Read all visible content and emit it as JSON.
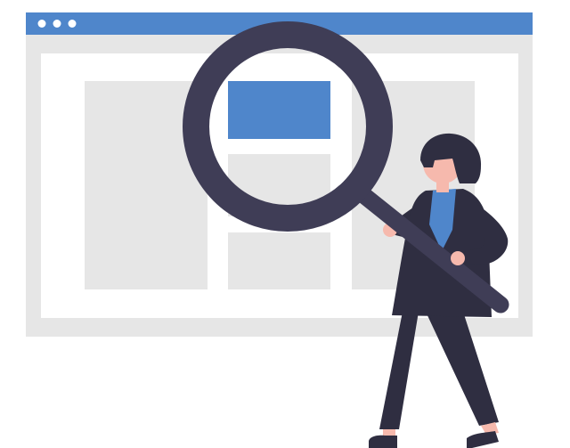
{
  "colors": {
    "background": "#ffffff",
    "titlebar": "#4f86cb",
    "window_frame": "#e6e6e6",
    "content_bg": "#ffffff",
    "panel": "#e6e6e6",
    "highlight_panel": "#4f86cb",
    "lens_ring": "#3f3d56",
    "lens_shadow": "#2f2e41",
    "clothing_dark": "#2f2e41",
    "shirt": "#4f86cb",
    "skin": "#f6b9ad",
    "hair": "#2f2e41",
    "dot": "#ffffff"
  },
  "icons": {
    "window_controls": [
      "window-dot-icon",
      "window-dot-icon",
      "window-dot-icon"
    ],
    "magnifier": "magnifying-glass-icon"
  }
}
